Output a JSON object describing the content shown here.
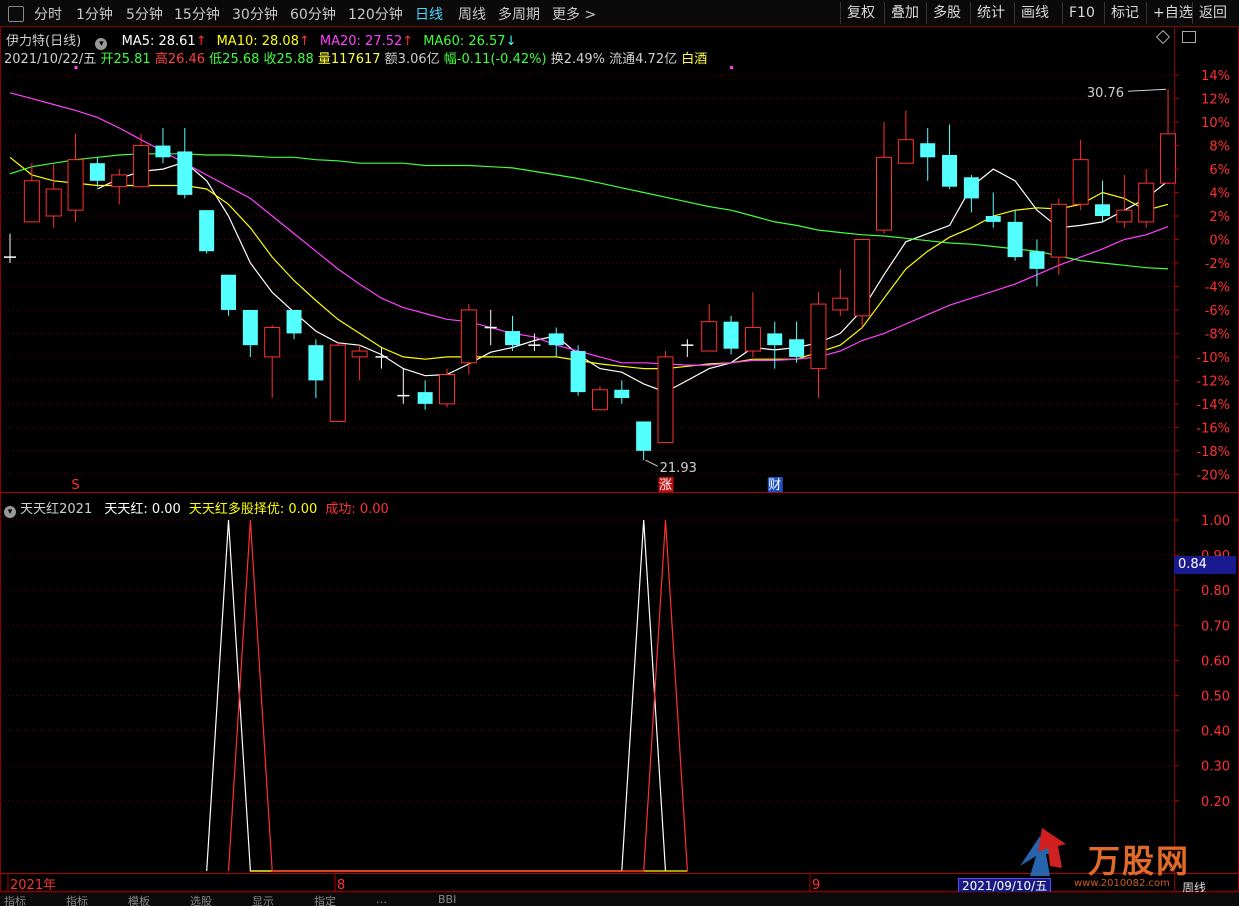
{
  "toolbar": {
    "periods": [
      "分时",
      "1分钟",
      "5分钟",
      "15分钟",
      "30分钟",
      "60分钟",
      "120分钟",
      "日线",
      "周线",
      "多周期",
      "更多 >"
    ],
    "active_period": "日线",
    "right_buttons": [
      "复权",
      "叠加",
      "多股",
      "统计",
      "画线",
      "F10",
      "标记",
      "+自选",
      "返回"
    ]
  },
  "main_chart": {
    "title": "伊力特(日线)",
    "ma": [
      {
        "name": "MA5",
        "label": "MA5: 28.61",
        "arrow": "↑",
        "color": "#ffffff",
        "arrow_color": "#ff3030"
      },
      {
        "name": "MA10",
        "label": "MA10: 28.08",
        "arrow": "↑",
        "color": "#ffff00",
        "arrow_color": "#ff3030"
      },
      {
        "name": "MA20",
        "label": "MA20: 27.52",
        "arrow": "↑",
        "color": "#ff40ff",
        "arrow_color": "#ff3030"
      },
      {
        "name": "MA60",
        "label": "MA60: 26.57",
        "arrow": "↓",
        "color": "#40ff40",
        "arrow_color": "#40ffff"
      }
    ],
    "quote": {
      "date": "2021/10/22/五",
      "open": "开25.81",
      "high": "高26.46",
      "low": "低25.68",
      "close": "收25.88",
      "volume": "量117617",
      "amount": "额3.06亿",
      "change": "幅-0.11(-0.42%)",
      "turnover": "换2.49%",
      "float": "流通4.72亿",
      "sector": "白酒"
    },
    "max_label": "30.76",
    "min_label": "21.93",
    "markers": [
      "S",
      "涨",
      "财"
    ],
    "icons": [
      "diamond-icon",
      "window-icon"
    ]
  },
  "chart_data": [
    {
      "type": "candlestick",
      "title": "伊力特(日线)",
      "ylabel": "",
      "y_ticks": [
        "14%",
        "12%",
        "10%",
        "8%",
        "6%",
        "4%",
        "2%",
        "0%",
        "-2%",
        "-4%",
        "-6%",
        "-8%",
        "-10%",
        "-12%",
        "-14%",
        "-16%",
        "-18%",
        "-20%"
      ],
      "ylim": [
        -21,
        15
      ],
      "x_ticks": [
        "2021年",
        "8",
        "9"
      ],
      "candles": [
        {
          "o": -1.5,
          "c": -1.5,
          "h": 0.5,
          "l": -2.0
        },
        {
          "o": 1.5,
          "c": 5.0,
          "h": 6.5,
          "l": 1.5
        },
        {
          "o": 2.0,
          "c": 4.3,
          "h": 6.5,
          "l": 1.0
        },
        {
          "o": 2.5,
          "c": 6.8,
          "h": 9.0,
          "l": 1.5
        },
        {
          "o": 6.5,
          "c": 5.0,
          "h": 7.0,
          "l": 4.5
        },
        {
          "o": 4.5,
          "c": 5.5,
          "h": 6.0,
          "l": 3.0
        },
        {
          "o": 4.5,
          "c": 8.0,
          "h": 9.0,
          "l": 4.5
        },
        {
          "o": 8.0,
          "c": 7.0,
          "h": 9.5,
          "l": 6.5
        },
        {
          "o": 7.5,
          "c": 3.8,
          "h": 9.5,
          "l": 3.5
        },
        {
          "o": 2.5,
          "c": -1.0,
          "h": 2.5,
          "l": -1.2
        },
        {
          "o": -3.0,
          "c": -6.0,
          "h": -3.0,
          "l": -6.5
        },
        {
          "o": -6.0,
          "c": -9.0,
          "h": -6.0,
          "l": -10.0
        },
        {
          "o": -10.0,
          "c": -7.5,
          "h": -7.3,
          "l": -13.5
        },
        {
          "o": -6.0,
          "c": -8.0,
          "h": -6.0,
          "l": -8.5
        },
        {
          "o": -9.0,
          "c": -12.0,
          "h": -8.5,
          "l": -13.5
        },
        {
          "o": -15.5,
          "c": -9.0,
          "h": -8.8,
          "l": -15.5
        },
        {
          "o": -10.0,
          "c": -9.5,
          "h": -9.0,
          "l": -12.0
        },
        {
          "o": -10.0,
          "c": -10.0,
          "h": -9.2,
          "l": -11.0
        },
        {
          "o": -13.5,
          "c": -13.3,
          "h": -11.0,
          "l": -14.0
        },
        {
          "o": -13.0,
          "c": -14.0,
          "h": -12.0,
          "l": -14.5
        },
        {
          "o": -14.0,
          "c": -11.5,
          "h": -11.0,
          "l": -14.3
        },
        {
          "o": -10.5,
          "c": -6.0,
          "h": -5.5,
          "l": -11.5
        },
        {
          "o": -7.5,
          "c": -7.5,
          "h": -6.0,
          "l": -9.0
        },
        {
          "o": -7.8,
          "c": -9.0,
          "h": -6.5,
          "l": -9.5
        },
        {
          "o": -9.0,
          "c": -9.2,
          "h": -8.0,
          "l": -9.5
        },
        {
          "o": -8.0,
          "c": -9.0,
          "h": -7.5,
          "l": -10.0
        },
        {
          "o": -9.5,
          "c": -13.0,
          "h": -9.0,
          "l": -13.3
        },
        {
          "o": -14.5,
          "c": -12.8,
          "h": -12.5,
          "l": -14.5
        },
        {
          "o": -12.8,
          "c": -13.5,
          "h": -12.0,
          "l": -14.0
        },
        {
          "o": -15.5,
          "c": -18.0,
          "h": -15.5,
          "l": -18.8
        },
        {
          "o": -17.3,
          "c": -10.0,
          "h": -9.5,
          "l": -17.3
        },
        {
          "o": -9.0,
          "c": -9.0,
          "h": -8.5,
          "l": -10.0
        },
        {
          "o": -9.5,
          "c": -7.0,
          "h": -5.5,
          "l": -9.5
        },
        {
          "o": -7.0,
          "c": -9.3,
          "h": -6.5,
          "l": -9.8
        },
        {
          "o": -9.5,
          "c": -7.5,
          "h": -4.5,
          "l": -10.0
        },
        {
          "o": -8.0,
          "c": -9.0,
          "h": -7.0,
          "l": -11.0
        },
        {
          "o": -8.5,
          "c": -10.0,
          "h": -7.0,
          "l": -10.5
        },
        {
          "o": -11.0,
          "c": -5.5,
          "h": -4.5,
          "l": -13.5
        },
        {
          "o": -6.0,
          "c": -5.0,
          "h": -2.5,
          "l": -6.5
        },
        {
          "o": -6.5,
          "c": 0.0,
          "h": 0.0,
          "l": -7.5
        },
        {
          "o": 0.8,
          "c": 7.0,
          "h": 10.0,
          "l": 0.5
        },
        {
          "o": 6.5,
          "c": 8.5,
          "h": 11.0,
          "l": 6.5
        },
        {
          "o": 8.2,
          "c": 7.0,
          "h": 9.5,
          "l": 5.0
        },
        {
          "o": 7.2,
          "c": 4.5,
          "h": 9.8,
          "l": 4.3
        },
        {
          "o": 5.3,
          "c": 3.5,
          "h": 5.5,
          "l": 2.3
        },
        {
          "o": 2.0,
          "c": 1.5,
          "h": 4.0,
          "l": 1.0
        },
        {
          "o": 1.5,
          "c": -1.5,
          "h": 2.5,
          "l": -1.8
        },
        {
          "o": -1.0,
          "c": -2.5,
          "h": 0.0,
          "l": -4.0
        },
        {
          "o": -1.5,
          "c": 3.0,
          "h": 3.5,
          "l": -3.0
        },
        {
          "o": 3.0,
          "c": 6.8,
          "h": 8.5,
          "l": 2.5
        },
        {
          "o": 3.0,
          "c": 2.0,
          "h": 5.0,
          "l": 1.5
        },
        {
          "o": 1.5,
          "c": 2.5,
          "h": 5.5,
          "l": 1.0
        },
        {
          "o": 1.5,
          "c": 4.8,
          "h": 6.0,
          "l": 1.0
        },
        {
          "o": 4.8,
          "c": 9.0,
          "h": 12.8,
          "l": 4.7
        }
      ],
      "series": [
        {
          "name": "MA5",
          "color": "#ffffff",
          "values": [
            null,
            null,
            null,
            null,
            4.3,
            5.2,
            5.8,
            6.0,
            6.6,
            5.0,
            2.0,
            -2.0,
            -4.5,
            -6.2,
            -7.8,
            -8.8,
            -9.0,
            -9.8,
            -11.0,
            -11.6,
            -11.5,
            -10.6,
            -9.6,
            -9.2,
            -8.6,
            -8.2,
            -9.8,
            -11.0,
            -11.3,
            -12.3,
            -13.0,
            -12.0,
            -11.0,
            -10.5,
            -9.2,
            -9.4,
            -9.2,
            -8.8,
            -8.0,
            -6.0,
            -3.0,
            -0.2,
            0.5,
            1.2,
            4.5,
            6.0,
            5.0,
            2.5,
            1.0,
            1.2,
            1.5,
            2.5,
            3.5,
            5.0
          ]
        },
        {
          "name": "MA10",
          "color": "#ffff00",
          "values": [
            7.0,
            5.5,
            5.0,
            4.8,
            4.6,
            4.6,
            4.6,
            4.6,
            4.6,
            4.3,
            3.0,
            1.0,
            -1.5,
            -3.5,
            -5.2,
            -6.8,
            -8.0,
            -9.2,
            -10.0,
            -10.2,
            -10.0,
            -10.0,
            -10.0,
            -10.0,
            -10.0,
            -10.0,
            -10.3,
            -10.6,
            -10.8,
            -11.0,
            -11.0,
            -10.8,
            -10.6,
            -10.5,
            -10.2,
            -10.2,
            -10.2,
            -9.6,
            -9.0,
            -7.5,
            -5.0,
            -2.5,
            -1.0,
            0.2,
            1.0,
            2.0,
            2.5,
            2.7,
            2.6,
            3.0,
            4.0,
            3.5,
            2.5,
            3.0
          ]
        },
        {
          "name": "MA20",
          "color": "#ff40ff",
          "values": [
            12.5,
            12.0,
            11.5,
            11.0,
            10.4,
            9.5,
            8.5,
            7.5,
            6.5,
            5.5,
            4.5,
            3.5,
            2.0,
            0.5,
            -1.0,
            -2.5,
            -3.8,
            -5.0,
            -5.8,
            -6.3,
            -6.8,
            -7.0,
            -7.5,
            -8.0,
            -8.3,
            -9.0,
            -9.5,
            -10.0,
            -10.5,
            -10.5,
            -10.6,
            -10.7,
            -10.7,
            -10.5,
            -10.3,
            -10.3,
            -10.2,
            -10.0,
            -9.5,
            -8.6,
            -8.0,
            -7.2,
            -6.4,
            -5.6,
            -5.0,
            -4.4,
            -3.8,
            -3.0,
            -2.2,
            -1.5,
            -0.8,
            0.0,
            0.4,
            1.1
          ]
        },
        {
          "name": "MA60",
          "color": "#40ff40",
          "values": [
            5.6,
            6.2,
            6.5,
            6.8,
            7.0,
            7.2,
            7.3,
            7.3,
            7.3,
            7.2,
            7.2,
            7.1,
            7.0,
            7.0,
            6.8,
            6.7,
            6.5,
            6.5,
            6.5,
            6.3,
            6.3,
            6.3,
            6.2,
            6.1,
            5.8,
            5.5,
            5.2,
            4.8,
            4.4,
            4.0,
            3.6,
            3.2,
            2.8,
            2.5,
            2.0,
            1.5,
            1.2,
            0.8,
            0.6,
            0.4,
            0.3,
            0.1,
            -0.1,
            -0.3,
            -0.4,
            -0.6,
            -0.8,
            -1.0,
            -1.4,
            -1.8,
            -2.0,
            -2.2,
            -2.4,
            -2.5
          ]
        }
      ]
    },
    {
      "type": "line",
      "title": "天天红2021",
      "y_ticks": [
        "1.00",
        "0.90",
        "0.80",
        "0.70",
        "0.60",
        "0.50",
        "0.40",
        "0.30",
        "0.20"
      ],
      "ylim": [
        0,
        1.05
      ],
      "series": [
        {
          "name": "天天红",
          "color": "#ffffff",
          "points": [
            [
              9.0,
              0
            ],
            [
              10.0,
              1
            ],
            [
              11.0,
              0
            ],
            [
              28.0,
              0
            ],
            [
              29.0,
              1
            ],
            [
              30.0,
              0
            ]
          ]
        },
        {
          "name": "天天红多股择优",
          "color": "#ffff00",
          "points": [
            [
              11.0,
              0
            ],
            [
              12.0,
              0
            ],
            [
              30.0,
              0
            ],
            [
              31.0,
              0
            ]
          ]
        },
        {
          "name": "成功",
          "color": "#ff3030",
          "points": [
            [
              10.0,
              0
            ],
            [
              11.0,
              1
            ],
            [
              12.0,
              0
            ],
            [
              29.0,
              0
            ],
            [
              30.0,
              1
            ],
            [
              31.0,
              0
            ]
          ]
        }
      ]
    }
  ],
  "indicator": {
    "name": "天天红2021",
    "labels": [
      {
        "text": "天天红: 0.00",
        "color": "#ffffff"
      },
      {
        "text": "天天红多股择优: 0.00",
        "color": "#ffff00"
      },
      {
        "text": "成功: 0.00",
        "color": "#ff3030"
      }
    ],
    "cursor_value": "0.84"
  },
  "bottom": {
    "x_labels": [
      "2021年",
      "8",
      "9"
    ],
    "date_box": "2021/09/10/五"
  },
  "statusbar": [
    "指标",
    "指标",
    "模板",
    "选股",
    "显示",
    "指定",
    "…",
    "BBI"
  ],
  "watermark": {
    "name": "万股网",
    "url": "www.2010082.com",
    "extra": "周线"
  },
  "colors": {
    "up": "#ff3030",
    "down": "#54ffff",
    "bg": "#000000",
    "grid": "#6b0000"
  }
}
